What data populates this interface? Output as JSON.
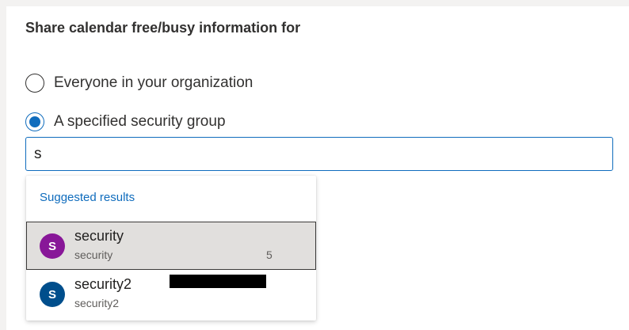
{
  "section": {
    "title": "Share calendar free/busy information for"
  },
  "options": [
    {
      "label": "Everyone in your organization",
      "checked": false
    },
    {
      "label": "A specified security group",
      "checked": true
    }
  ],
  "search": {
    "value": "s"
  },
  "suggestions": {
    "header": "Suggested results",
    "items": [
      {
        "initial": "S",
        "name": "security",
        "sub": "security",
        "sub_suffix": "5",
        "avatar_color": "#881798",
        "selected": true
      },
      {
        "initial": "S",
        "name": "security2",
        "sub": "security2",
        "avatar_color": "#004e8c",
        "selected": false
      }
    ]
  },
  "colors": {
    "accent": "#0f6cbd",
    "header_text": "#0f6cbd",
    "selected_bg": "#e1dfdd"
  }
}
